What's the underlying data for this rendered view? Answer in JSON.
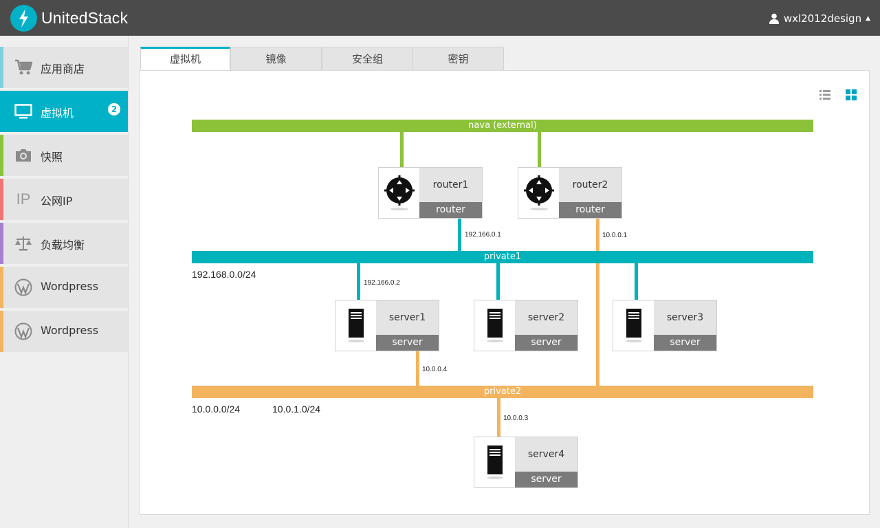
{
  "header": {
    "brand": "UnitedStack",
    "username": "wxl2012design",
    "colors": {
      "bg": "#4b4b4b",
      "logo": "#00b1c7"
    }
  },
  "sidebar": {
    "items": [
      {
        "label": "应用商店",
        "icon": "cart-icon",
        "color": "#7dd1df"
      },
      {
        "label": "虚拟机",
        "icon": "monitor-icon",
        "color": "#00b1c7",
        "active": true,
        "badge": "2"
      },
      {
        "label": "快照",
        "icon": "camera-icon",
        "color": "#8cc13a"
      },
      {
        "label": "公网IP",
        "icon": "ip-icon",
        "icon_text": "IP",
        "color": "#f07474"
      },
      {
        "label": "负载均衡",
        "icon": "scale-icon",
        "color": "#a77fcf"
      },
      {
        "label": "Wordpress",
        "icon": "wordpress-icon",
        "color": "#f0b55e"
      },
      {
        "label": "Wordpress",
        "icon": "wordpress-icon",
        "color": "#f0b55e"
      }
    ]
  },
  "tabs": [
    {
      "label": "虚拟机",
      "active": true
    },
    {
      "label": "镜像"
    },
    {
      "label": "安全组"
    },
    {
      "label": "密钥"
    }
  ],
  "view_toggle": {
    "list": "list-view-icon",
    "grid": "grid-view-icon",
    "active": "grid"
  },
  "topology": {
    "colors": {
      "external": "#8cc13a",
      "private1": "#00b2b9",
      "private2": "#f2b45f"
    },
    "networks": {
      "external": "nava (external)",
      "private1": "private1",
      "private2": "private2"
    },
    "subnets": {
      "private1": "192.168.0.0/24",
      "private2_a": "10.0.0.0/24",
      "private2_b": "10.0.1.0/24"
    },
    "ips": {
      "router1_p1": "192.166.0.1",
      "router2_p2": "10.0.0.1",
      "server1_p1": "192.166.0.2",
      "server1_p2": "10.0.0.4",
      "server4_p2": "10.0.0.3"
    },
    "nodes": {
      "router1": {
        "name": "router1",
        "type": "router"
      },
      "router2": {
        "name": "router2",
        "type": "router"
      },
      "server1": {
        "name": "server1",
        "type": "server"
      },
      "server2": {
        "name": "server2",
        "type": "server"
      },
      "server3": {
        "name": "server3",
        "type": "server"
      },
      "server4": {
        "name": "server4",
        "type": "server"
      }
    }
  }
}
